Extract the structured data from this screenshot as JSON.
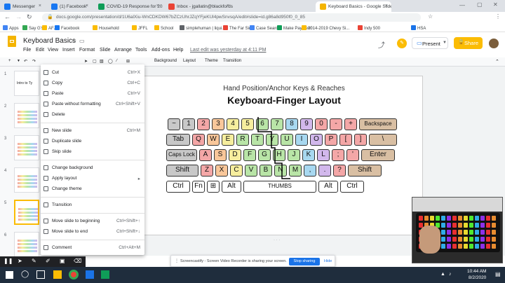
{
  "browser": {
    "tabs": [
      {
        "label": "Messenger",
        "color": "#1877f2"
      },
      {
        "label": "(1) Facebook",
        "color": "#1877f2"
      },
      {
        "label": "COVID-19 Response for 2020 Sc...",
        "color": "#0f9d58"
      },
      {
        "label": "Inbox - jgallatin@blackfordsch...",
        "color": "#ea4335"
      },
      {
        "label": "Keyboard Basics - Google Slides",
        "color": "#f4b400"
      }
    ],
    "url": "docs.google.com/presentation/d/1U6alXiu-WnCDKDW67bZCzUhrJZqYFjeKUl4pwSnvsqA/edit#slide=id.g86a8d950f0_0_85",
    "bookmarks": [
      "Apps",
      "Say G's",
      "AFJ",
      "Facebook",
      "Household",
      "JFFL",
      "School",
      "simplehuman | liqui...",
      "The Far Side",
      "Case Search",
      "Make Payment",
      "2014-2019 Chevy Si...",
      "Indy 500",
      "HSA"
    ]
  },
  "app": {
    "title": "Keyboard Basics",
    "menus": [
      "File",
      "Edit",
      "View",
      "Insert",
      "Format",
      "Slide",
      "Arrange",
      "Tools",
      "Add-ons",
      "Help"
    ],
    "last_edit": "Last edit was yesterday at 4:11 PM",
    "present_label": "Present",
    "share_label": "Share",
    "toolbar": [
      "Background",
      "Layout",
      "Theme",
      "Transition"
    ]
  },
  "context_menu": {
    "items": [
      {
        "label": "Cut",
        "shortcut": "Ctrl+X"
      },
      {
        "label": "Copy",
        "shortcut": "Ctrl+C"
      },
      {
        "label": "Paste",
        "shortcut": "Ctrl+V"
      },
      {
        "label": "Paste without formatting",
        "shortcut": "Ctrl+Shift+V"
      },
      {
        "label": "Delete",
        "shortcut": ""
      },
      {
        "label": "New slide",
        "shortcut": "Ctrl+M"
      },
      {
        "label": "Duplicate slide",
        "shortcut": ""
      },
      {
        "label": "Skip slide",
        "shortcut": ""
      },
      {
        "label": "Change background",
        "shortcut": ""
      },
      {
        "label": "Apply layout",
        "shortcut": "▸"
      },
      {
        "label": "Change theme",
        "shortcut": ""
      },
      {
        "label": "Transition",
        "shortcut": ""
      },
      {
        "label": "Move slide to beginning",
        "shortcut": "Ctrl+Shift+↑"
      },
      {
        "label": "Move slide to end",
        "shortcut": "Ctrl+Shift+↓"
      },
      {
        "label": "Comment",
        "shortcut": "Ctrl+Alt+M"
      }
    ]
  },
  "filmstrip": {
    "numbers": [
      "1",
      "2",
      "3",
      "4",
      "5",
      "6"
    ],
    "slide1_text": "Intro to Ty"
  },
  "slide": {
    "subtitle": "Hand Position/Anchor Keys & Reaches",
    "title": "Keyboard-Finger Layout",
    "rows": [
      [
        [
          "~",
          "#c8c8c8"
        ],
        [
          "1",
          "#c8c8c8"
        ],
        [
          "2",
          "#f4a7a7"
        ],
        [
          "3",
          "#f9c79a"
        ],
        [
          "4",
          "#f6ee9e"
        ],
        [
          "5",
          "#f6ee9e"
        ],
        [
          "6",
          "#b9e5a7"
        ],
        [
          "7",
          "#b9e5a7"
        ],
        [
          "8",
          "#a8d8f0"
        ],
        [
          "9",
          "#d2b8ec"
        ],
        [
          "0",
          "#f4a7a7"
        ],
        [
          "-",
          "#f4a7a7"
        ],
        [
          "+",
          "#f4a7a7"
        ],
        [
          "Backspace",
          "#d9bfa3"
        ]
      ],
      [
        [
          "Tab",
          "#c8c8c8"
        ],
        [
          "Q",
          "#f4a7a7"
        ],
        [
          "W",
          "#f9c79a"
        ],
        [
          "E",
          "#f6ee9e"
        ],
        [
          "R",
          "#b9e5a7"
        ],
        [
          "T",
          "#b9e5a7"
        ],
        [
          "Y",
          "#b9e5a7"
        ],
        [
          "U",
          "#b9e5a7"
        ],
        [
          "I",
          "#a8d8f0"
        ],
        [
          "O",
          "#d2b8ec"
        ],
        [
          "P",
          "#f4a7a7"
        ],
        [
          "[",
          "#f4a7a7"
        ],
        [
          "]",
          "#f4a7a7"
        ],
        [
          "\\",
          "#d9bfa3"
        ]
      ],
      [
        [
          "Caps Lock",
          "#c8c8c8"
        ],
        [
          "A",
          "#f4a7a7"
        ],
        [
          "S",
          "#f9c79a"
        ],
        [
          "D",
          "#f6ee9e"
        ],
        [
          "F",
          "#b9e5a7"
        ],
        [
          "G",
          "#b9e5a7"
        ],
        [
          "H",
          "#b9e5a7"
        ],
        [
          "J",
          "#b9e5a7"
        ],
        [
          "K",
          "#a8d8f0"
        ],
        [
          "L",
          "#d2b8ec"
        ],
        [
          ";",
          "#f4a7a7"
        ],
        [
          "'",
          "#f4a7a7"
        ],
        [
          "Enter",
          "#d9bfa3"
        ]
      ],
      [
        [
          "Shift",
          "#c8c8c8"
        ],
        [
          "Z",
          "#f4a7a7"
        ],
        [
          "X",
          "#f9c79a"
        ],
        [
          "C",
          "#f6ee9e"
        ],
        [
          "V",
          "#b9e5a7"
        ],
        [
          "B",
          "#b9e5a7"
        ],
        [
          "N",
          "#b9e5a7"
        ],
        [
          "M",
          "#b9e5a7"
        ],
        [
          ",",
          "#a8d8f0"
        ],
        [
          ".",
          "#d2b8ec"
        ],
        [
          "?",
          "#f4a7a7"
        ],
        [
          "Shift",
          "#d9bfa3"
        ]
      ],
      [
        [
          "Ctrl",
          "#ffffff"
        ],
        [
          "Fn",
          "#ffffff"
        ],
        [
          "⊞",
          "#ffffff"
        ],
        [
          "Alt",
          "#ffffff"
        ],
        [
          "THUMBS",
          "#ffffff"
        ],
        [
          "Alt",
          "#ffffff"
        ],
        [
          "Ctrl",
          "#ffffff"
        ]
      ]
    ]
  },
  "notice": {
    "text": "Screencastify - Screen Video Recorder is sharing your screen.",
    "stop_label": "Stop sharing",
    "hide_label": "Hide"
  },
  "taskbar": {
    "time": "10:44 AM",
    "date": "8/2/2020"
  }
}
